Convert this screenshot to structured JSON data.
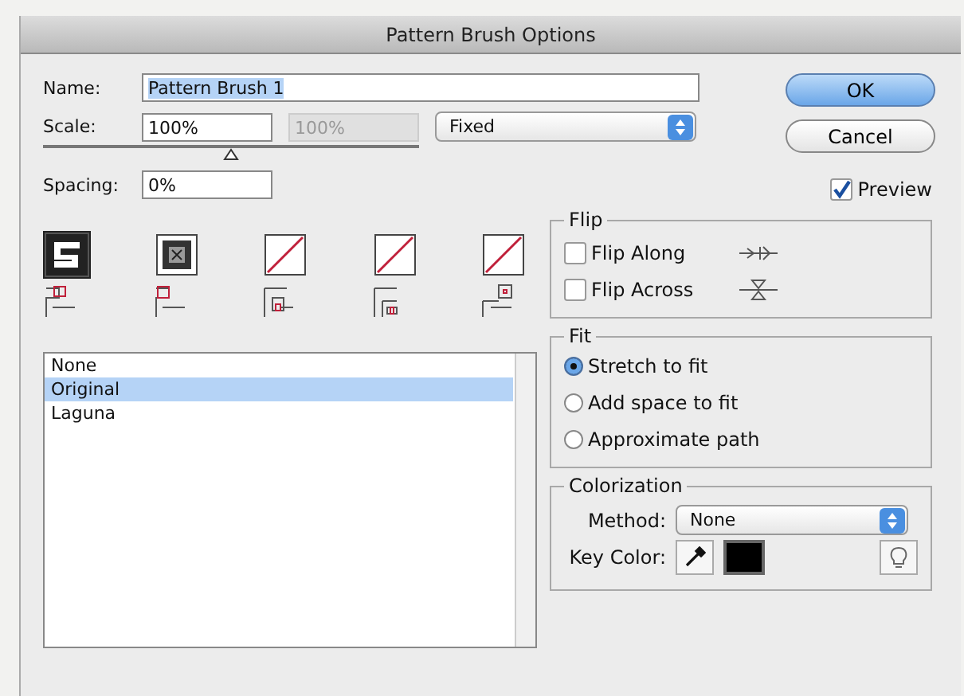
{
  "window": {
    "title": "Pattern Brush Options"
  },
  "name_field": {
    "label": "Name:",
    "value": "Pattern Brush 1"
  },
  "scale": {
    "label": "Scale:",
    "value": "100%",
    "max_value": "100%",
    "max_disabled": true,
    "mode": "Fixed",
    "level": 0.5
  },
  "spacing": {
    "label": "Spacing:",
    "value": "0%"
  },
  "buttons": [
    {
      "label": "OK",
      "default": true
    },
    {
      "label": "Cancel",
      "default": false
    }
  ],
  "preview": {
    "label": "Preview",
    "checked": true
  },
  "tiles": [
    {
      "kind": "side",
      "empty": false,
      "selected": true
    },
    {
      "kind": "outer_corner",
      "empty": false,
      "selected": false
    },
    {
      "kind": "inner_corner",
      "empty": true,
      "selected": false
    },
    {
      "kind": "start",
      "empty": true,
      "selected": false
    },
    {
      "kind": "end",
      "empty": true,
      "selected": false
    }
  ],
  "pattern_list": [
    {
      "label": "None",
      "selected": false
    },
    {
      "label": "Original",
      "selected": true
    },
    {
      "label": "Laguna",
      "selected": false
    }
  ],
  "flip": {
    "title": "Flip",
    "options": [
      {
        "kind": "along",
        "label": "Flip Along",
        "checked": false
      },
      {
        "kind": "across",
        "label": "Flip Across",
        "checked": false
      }
    ]
  },
  "fit": {
    "title": "Fit",
    "options": [
      {
        "label": "Stretch to fit",
        "selected": true
      },
      {
        "label": "Add space to fit",
        "selected": false
      },
      {
        "label": "Approximate path",
        "selected": false
      }
    ]
  },
  "colorization": {
    "title": "Colorization",
    "method_label": "Method:",
    "method": "None",
    "key_color_label": "Key Color:"
  }
}
